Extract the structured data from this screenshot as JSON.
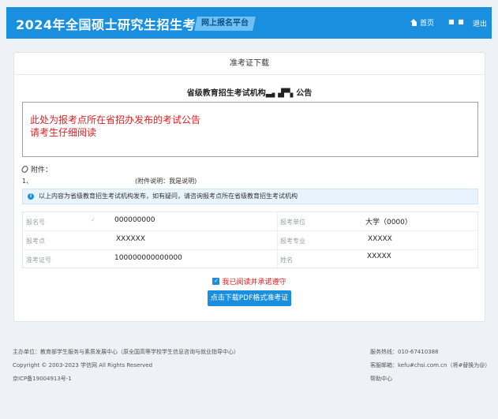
{
  "header": {
    "title": "2024年全国硕士研究生招生考试",
    "platform": "网上报名平台",
    "home": "首页",
    "user": "■ ■",
    "logout": "退出"
  },
  "card": {
    "title": "准考证下载",
    "notice_title": "省级教育招生考试机构▃▖▟▀▖公告",
    "notice_lines": [
      "此处为报考点所在省招办发布的考试公告",
      "请考生仔细阅读"
    ],
    "attachments_label": "附件：",
    "attachment_index": "1、",
    "attachment_desc": "(附件说明：我是说明)",
    "info_text": "以上内容为省级教育招生考试机构发布，如有疑问，请咨询报考点所在省级教育招生考试机构",
    "fields": [
      {
        "label": "报名号",
        "value": "000000000",
        "label2": "报考单位",
        "value2": "大学（0000）"
      },
      {
        "label": "报考点",
        "value": "XXXXXX",
        "label2": "报考专业",
        "value2": "XXXXX"
      },
      {
        "label": "准考证号",
        "value": "100000000000000",
        "label2": "姓名",
        "value2": "XXXXX"
      }
    ],
    "check_mark": "✓",
    "agree_text": "我已阅读并承诺遵守",
    "download_button": "点击下载PDF格式准考证"
  },
  "footer": {
    "host": "主办单位：教育部学生服务与素质发展中心（原全国高等学校学生信息咨询与就业指导中心）",
    "copyright": "Copyright © 2003-2023 学信网 All Rights Reserved",
    "icp": "京ICP备19004913号-1",
    "hotline": "服务热线：010-67410388",
    "email": "客服邮箱：kefu#chsi.com.cn（将#替换为@）",
    "help": "帮助中心"
  },
  "colors": {
    "primary": "#1a8fe0",
    "alert": "#e02020",
    "info_bg": "#e8f4fd"
  },
  "icons": {
    "home": "home-icon",
    "attachment": "paperclip-icon",
    "info": "info-icon",
    "checkbox": "checkbox-checked-icon"
  }
}
